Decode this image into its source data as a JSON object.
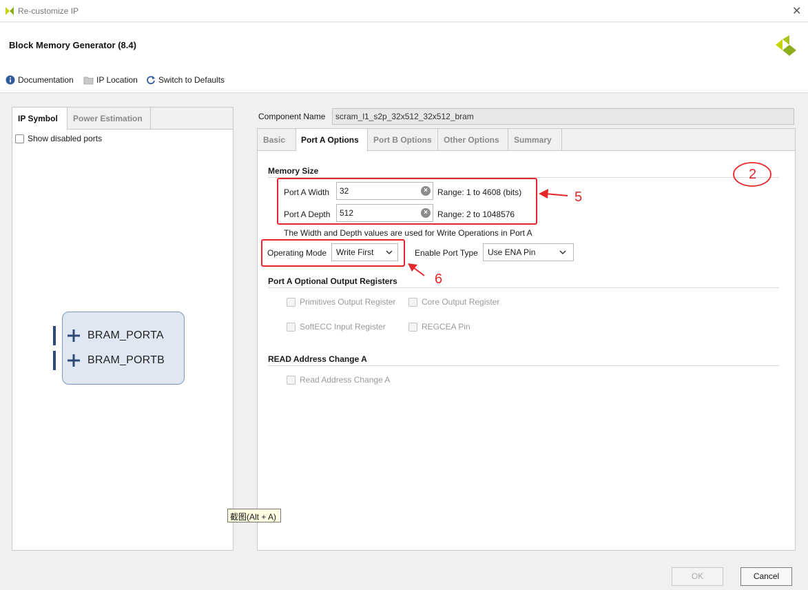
{
  "window": {
    "title": "Re-customize IP",
    "close_glyph": "✕"
  },
  "header": {
    "title": "Block Memory Generator (8.4)"
  },
  "toolbar": [
    {
      "label": "Documentation",
      "icon": "info-icon"
    },
    {
      "label": "IP Location",
      "icon": "folder-icon"
    },
    {
      "label": "Switch to Defaults",
      "icon": "refresh-icon"
    }
  ],
  "left": {
    "tabs": [
      "IP Symbol",
      "Power Estimation"
    ],
    "show_disabled_ports": "Show disabled ports",
    "ports": [
      "BRAM_PORTA",
      "BRAM_PORTB"
    ]
  },
  "component": {
    "label": "Component Name",
    "value": "scram_l1_s2p_32x512_32x512_bram"
  },
  "tabs": [
    "Basic",
    "Port A Options",
    "Port B Options",
    "Other Options",
    "Summary"
  ],
  "memory_size": {
    "title": "Memory Size",
    "width_label": "Port A Width",
    "width_value": "32",
    "width_range": "Range: 1 to 4608 (bits)",
    "depth_label": "Port A Depth",
    "depth_value": "512",
    "depth_range": "Range: 2 to 1048576",
    "note": "The Width and Depth values are used for Write Operations in Port A"
  },
  "operating_mode": {
    "label": "Operating Mode",
    "value": "Write First"
  },
  "enable_port": {
    "label": "Enable Port Type",
    "value": "Use ENA Pin"
  },
  "optional_regs": {
    "title": "Port A Optional Output Registers",
    "items": [
      "Primitives Output Register",
      "Core Output Register",
      "SoftECC Input Register",
      "REGCEA Pin"
    ]
  },
  "read_addr": {
    "title": "READ Address Change A",
    "item": "Read Address Change A"
  },
  "annotations": {
    "circle": "2",
    "arrow5": "5",
    "arrow6": "6"
  },
  "tooltip": "截图(Alt + A)",
  "buttons": {
    "ok": "OK",
    "cancel": "Cancel"
  },
  "colors": {
    "accent_red": "#e8262a",
    "symbol_fill": "#dfe8f2",
    "port_blue": "#2c4a78"
  }
}
